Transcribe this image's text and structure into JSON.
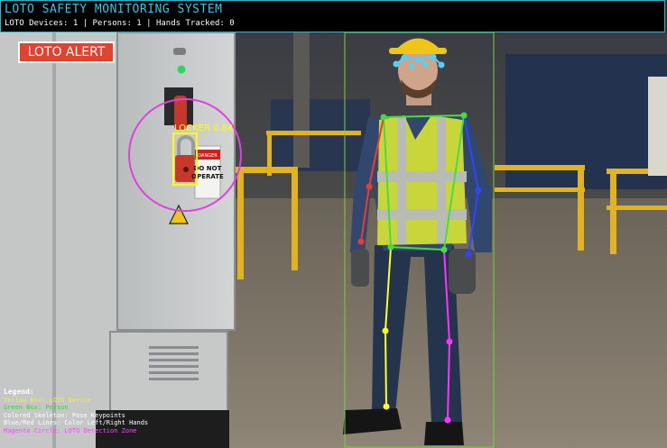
{
  "header": {
    "title": "LOTO SAFETY MONITORING SYSTEM",
    "stats": "LOTO Devices: 1 | Persons: 1 | Hands Tracked: 0"
  },
  "alert": {
    "label": "LOTO ALERT"
  },
  "detection": {
    "label": "LOCKER 0.84",
    "box_color": "#ffff00",
    "zone_color": "#e040e0"
  },
  "sign": {
    "header": "DANGER",
    "line1": "DO NOT",
    "line2": "OPERATE"
  },
  "person": {
    "box_color": "#7ccf3a",
    "skeleton_colors": {
      "torso": "#44dd44",
      "left_arm": "#ee3b2c",
      "right_arm": "#2f45ff",
      "left_leg": "#ffff22",
      "right_leg": "#ff33ff",
      "face": "#4ed2ff"
    }
  },
  "legend": {
    "title": "Legend:",
    "items": [
      {
        "text": "Yellow Box: LOTO Device",
        "color": "#f4f036"
      },
      {
        "text": "Green Box: Person",
        "color": "#3ad43a"
      },
      {
        "text": "Colored Skeleton: Pose Keypoints",
        "color": "#ffffff"
      },
      {
        "text": "Blue/Red Lines: Color Left/Right Hands",
        "color": "#ffffff"
      },
      {
        "text": "Magenta Circle: LOTO Detection Zone",
        "color": "#ff44ff"
      }
    ]
  }
}
